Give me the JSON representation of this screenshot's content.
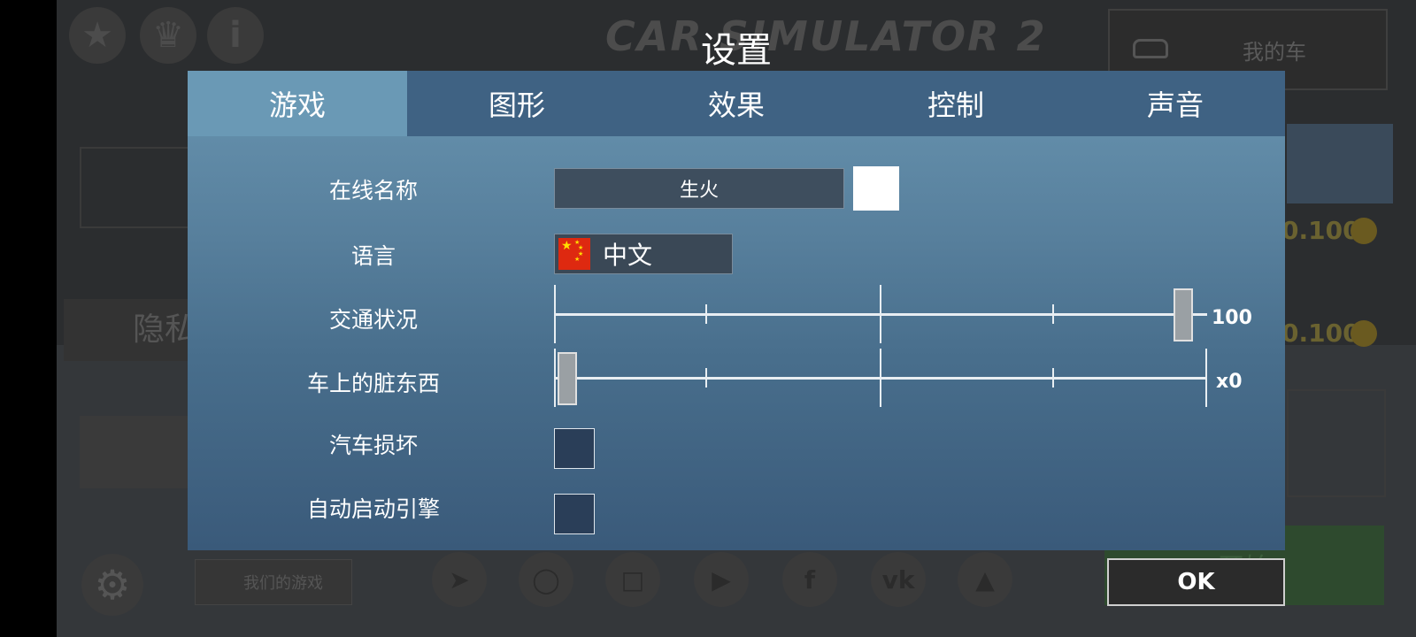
{
  "background": {
    "game_logo": "CAR SIMULATOR 2",
    "my_car_label": "我的车",
    "privacy_label": "隐私",
    "our_games_label": "我们的游戏",
    "start_label": "开始",
    "prices": [
      "0.100",
      "0.100"
    ],
    "top_icons": [
      "award-icon",
      "trophy-icon",
      "info-icon"
    ],
    "social_icons": [
      "telegram-icon",
      "instagram-icon",
      "twitch-icon",
      "youtube-icon",
      "facebook-icon",
      "vk-icon",
      "like-icon"
    ]
  },
  "dialog": {
    "title": "设置",
    "tabs": [
      {
        "label": "游戏",
        "active": true
      },
      {
        "label": "图形",
        "active": false
      },
      {
        "label": "效果",
        "active": false
      },
      {
        "label": "控制",
        "active": false
      },
      {
        "label": "声音",
        "active": false
      }
    ],
    "online_name": {
      "label": "在线名称",
      "value": "生火",
      "color": "#ffffff"
    },
    "language": {
      "label": "语言",
      "value": "中文",
      "flag": "china-flag-icon"
    },
    "traffic": {
      "label": "交通状况",
      "value_text": "100",
      "level": 1.0
    },
    "dirt": {
      "label": "车上的脏东西",
      "value_text": "x0",
      "level": 0.0
    },
    "car_damage": {
      "label": "汽车损坏",
      "checked": false
    },
    "auto_start": {
      "label": "自动启动引擎",
      "checked": false
    },
    "ok_label": "OK"
  },
  "colors": {
    "tab_bar": "#3f6283",
    "tab_active": "#6a99b5",
    "checkbox_fill": "#2a3e58"
  }
}
